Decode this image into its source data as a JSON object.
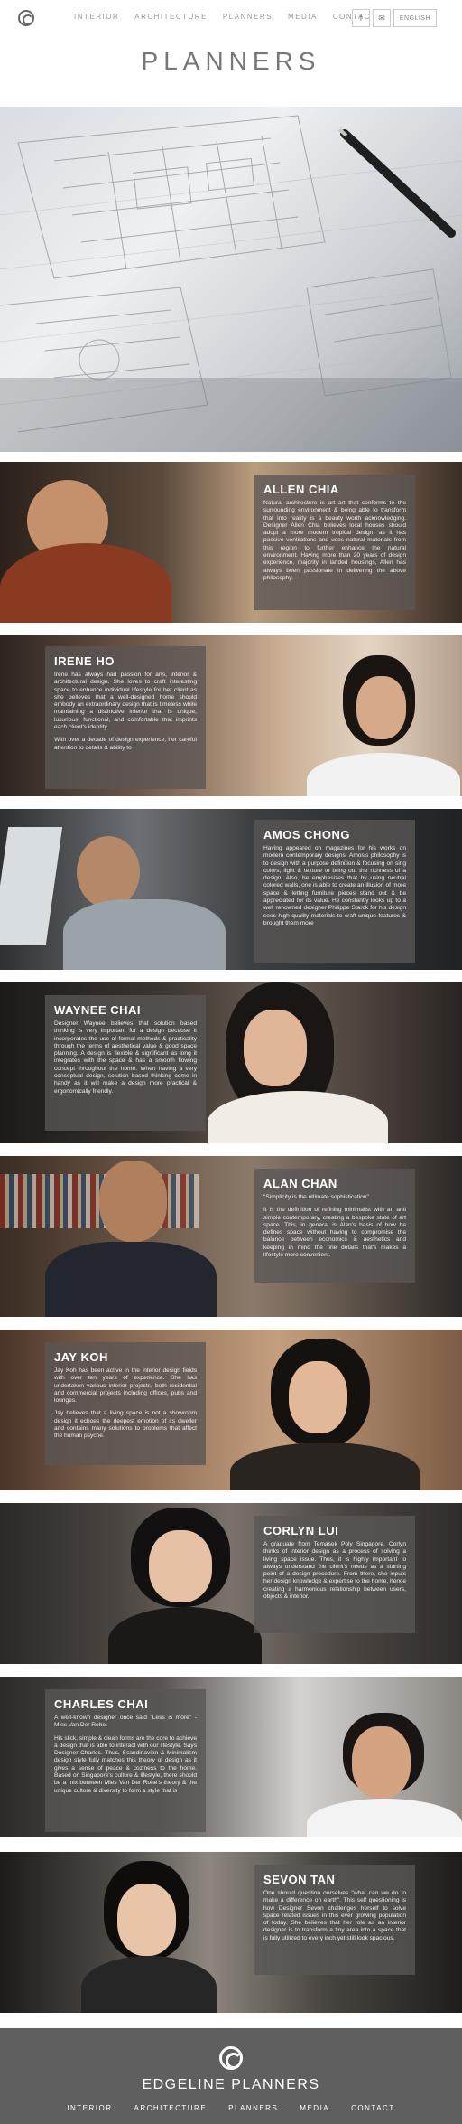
{
  "nav": [
    "INTERIOR",
    "ARCHITECTURE",
    "PLANNERS",
    "MEDIA",
    "CONTACT"
  ],
  "social": {
    "facebook": "f",
    "email": "✉"
  },
  "language": "ENGLISH",
  "page_title": "PLANNERS",
  "planners": [
    {
      "name": "ALLEN CHIA",
      "paragraphs": [
        "Natural architecture is art art that conforms to the surrounding environment & being able to transform that into reality is a beauty worth acknowledging. Designer Allen Chia believes local houses should adopt a more modern tropical design, as it has passive ventilations and uses natural materials from this region to further enhance the natural environment. Having more than 20 years of design experience, majority in landed housings, Allen has always been passionate in delivering the above philosophy."
      ]
    },
    {
      "name": "IRENE HO",
      "paragraphs": [
        "Irene has always had passion for arts, interior & architectural design. She loves to craft interesting space to enhance individual lifestyle for her client as she believes that a well-designed home should embody an extraordinary design that is timeless while maintaining a distinctive interior that is unique, luxurious, functional, and comfortable that imprints each client's identity.",
        "With over a decade of design experience, her careful attention to details & ability to"
      ]
    },
    {
      "name": "AMOS CHONG",
      "paragraphs": [
        "Having appeared on magazines for his works on modern contemporary designs, Amos's philosophy is to design with a purpose definition & focusing on sing colors, light & texture to bring out the richness of a design. Also, he emphasizes that by using neutral colored walls, one is able to create an illusion of more space & letting furniture pieces stand out & be appreciated for its value. He constantly looks up to a well renowned designer Philippe Starck for his design sees high quality materials to craft unique features & brought them more"
      ]
    },
    {
      "name": "WAYNEE CHAI",
      "paragraphs": [
        "Designer Waynee believes that solution based thinking is very important for a design because it incorporates the use of formal methods & practicality through the terms of aesthetical value & good space planning. A design is flexible & significant as long it integrates with the space & has a smooth flowing concept throughout the home. When having a very conceptual design, solution based thinking come in handy as it will make a design more practical & ergonomically friendly."
      ]
    },
    {
      "name": "ALAN CHAN",
      "paragraphs": [
        "\"Simplicity is the ultimate sophistication\"",
        "It is the definition of refining minimalist with an anti simple contemporary, creating a bespoke state of art space. This, in general is Alan's basis of how he defines space without having to compromise the balance between economics & aesthetics and keeping in mind the fine details that's makes a lifestyle more convenient."
      ]
    },
    {
      "name": "JAY KOH",
      "paragraphs": [
        "Jay Koh has been active in the interior design fields with over ten years of experience. She has undertaken various interior projects, both residential and commercial projects including offices, pubs and lounges.",
        "Jay believes that a living space is not a showroom design it echoes the deepest emotion of its dweller and contains many solutions to problems that affect the human psyche."
      ]
    },
    {
      "name": "CORLYN LUI",
      "paragraphs": [
        "A graduate from Temasek Poly Singapore, Corlyn thinks of interior design as a process of solving a living space issue. Thus, it is highly important to always understand the client's needs as a starting point of a design procedure. From there, she inputs her design knowledge & expertise to the home, hence creating a harmonious relationship between users, objects & interior."
      ]
    },
    {
      "name": "CHARLES CHAI",
      "paragraphs": [
        "A well-known designer once said \"Less is more\" - Mies Van Der Rohe.",
        "His slick, simple & clean forms are the core to achieve a design that is able to interact with our lifestyle. Says Designer Charles. Thus, Scandinavian & Minimalism design style fully matches this theory of design as it gives a sense of peace & coziness to the home. Based on Singapore's culture & lifestyle, there should be a mix between Mies Van Der Rohe's theory & the unique culture & diversity to form a style that is"
      ]
    },
    {
      "name": "SEVON TAN",
      "paragraphs": [
        "One should question ourselves \"what can we do to make a difference on earth\". This self questioning is how Designer Sevon challenges herself to solve space related issues in this ever growing population of today. She believes that her role as an interior designer is to transform a tiny area into a space that is fully utilized to every inch yet still look spacious."
      ]
    }
  ],
  "footer": {
    "brand": "EDGELINE PLANNERS",
    "nav": [
      "INTERIOR",
      "ARCHITECTURE",
      "PLANNERS",
      "MEDIA",
      "CONTACT"
    ]
  }
}
